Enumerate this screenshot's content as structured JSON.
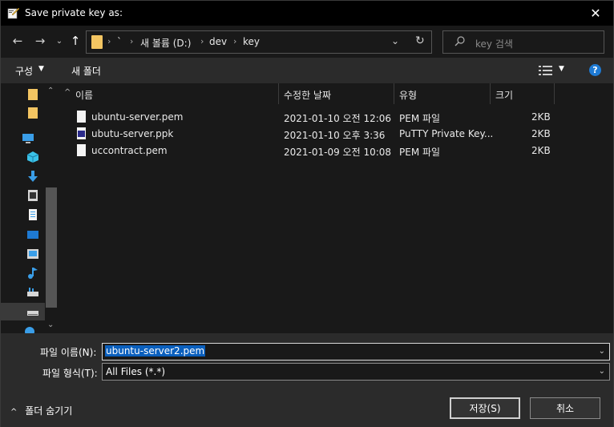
{
  "window": {
    "title": "Save private key as:"
  },
  "nav": {
    "breadcrumbs": [
      "`",
      "새 볼륨 (D:)",
      "dev",
      "key"
    ],
    "search_placeholder": "key 검색"
  },
  "toolbar": {
    "organize_label": "구성",
    "new_folder_label": "새 폴더",
    "help_label": "?"
  },
  "columns": [
    "이름",
    "수정한 날짜",
    "유형",
    "크기"
  ],
  "files": [
    {
      "name": "ubuntu-server.pem",
      "modified": "2021-01-10 오전 12:06",
      "type": "PEM 파일",
      "size": "2KB",
      "icon": "document-icon"
    },
    {
      "name": "ubutu-server.ppk",
      "modified": "2021-01-10 오후 3:36",
      "type": "PuTTY Private Key...",
      "size": "2KB",
      "icon": "putty-key-icon"
    },
    {
      "name": "uccontract.pem",
      "modified": "2021-01-09 오전 10:08",
      "type": "PEM 파일",
      "size": "2KB",
      "icon": "document-icon"
    }
  ],
  "form": {
    "filename_label": "파일 이름(N):",
    "filename_value": "ubuntu-server2.pem",
    "filetype_label": "파일 형식(T):",
    "filetype_value": "All Files (*.*)"
  },
  "buttons": {
    "hide_folders": "폴더 숨기기",
    "save": "저장(S)",
    "cancel": "취소"
  }
}
